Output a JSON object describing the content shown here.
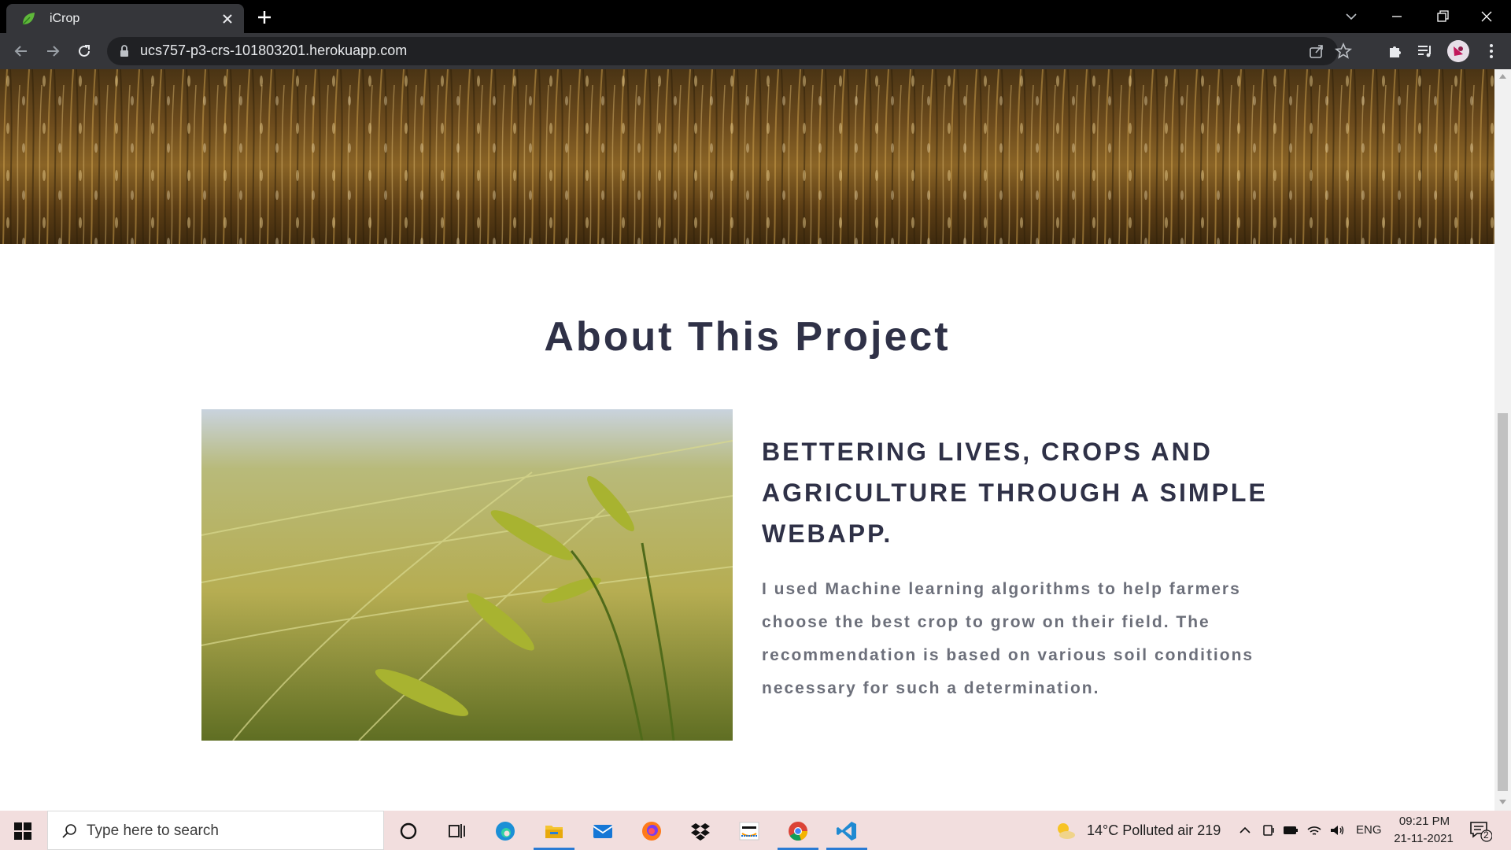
{
  "browser": {
    "tab_title": "iCrop",
    "url": "ucs757-p3-crs-101803201.herokuapp.com"
  },
  "page": {
    "section_title": "About This Project",
    "about_heading": "BETTERING LIVES, CROPS AND AGRICULTURE THROUGH A SIMPLE WEBAPP.",
    "about_text": "I used Machine learning algorithms to help farmers choose the best crop to grow on their field. The recommendation is based on various soil conditions necessary for such a determination."
  },
  "taskbar": {
    "search_placeholder": "Type here to search",
    "weather": "14°C  Polluted air 219",
    "language": "ENG",
    "time": "09:21 PM",
    "date": "21-11-2021",
    "notification_count": "2",
    "pinned_apps": [
      "cortana-icon",
      "task-view-icon",
      "edge-icon",
      "file-explorer-icon",
      "mail-icon",
      "firefox-icon",
      "dropbox-icon",
      "amazon-icon",
      "chrome-icon",
      "vscode-icon"
    ]
  },
  "colors": {
    "heading": "#2f3147",
    "body_text": "#6c6f7a",
    "tab_bar": "#000000",
    "toolbar": "#35363a",
    "taskbar": "#f2dede",
    "taskbar_accent": "#2b7bd4"
  }
}
